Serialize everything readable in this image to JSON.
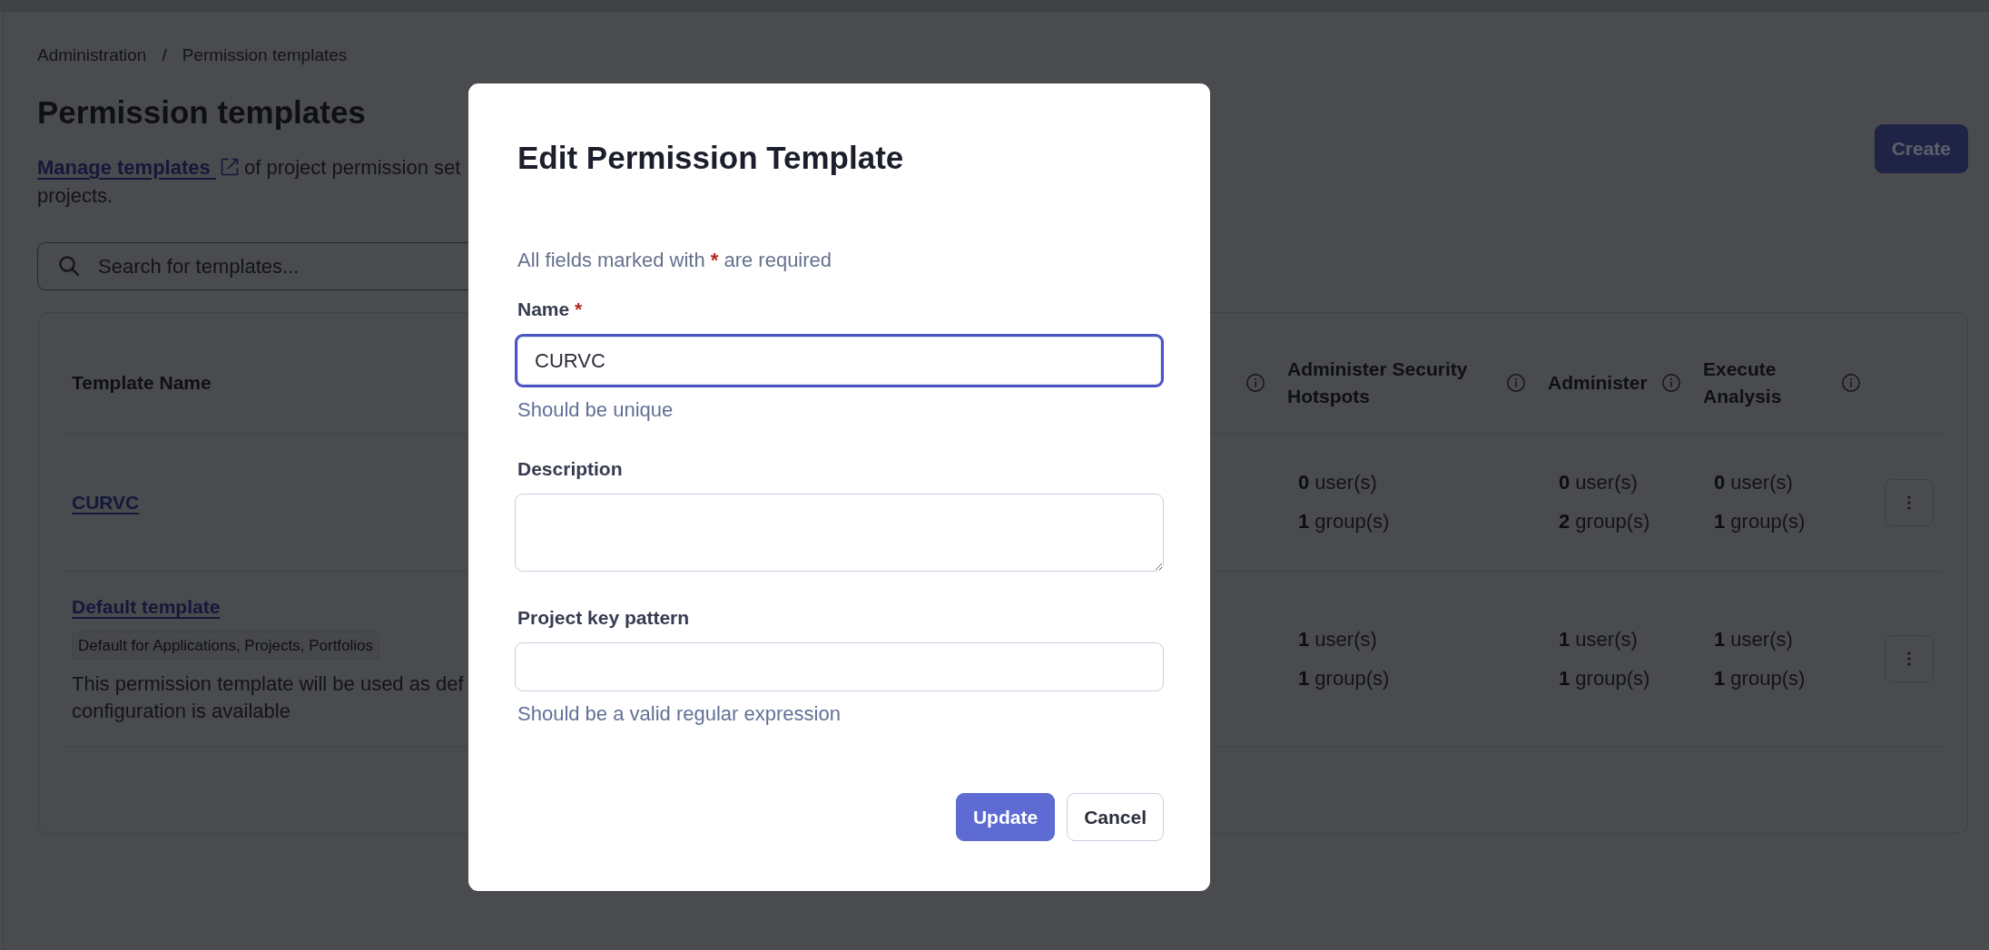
{
  "breadcrumbs": {
    "items": [
      "Administration",
      "Permission templates"
    ],
    "separator": "/"
  },
  "page": {
    "title": "Permission templates",
    "description": {
      "link": "Manage templates",
      "lines": [
        "of project permission set",
        "projects."
      ]
    },
    "create_button": "Create"
  },
  "search": {
    "placeholder": "Search for templates..."
  },
  "table": {
    "columns": [
      {
        "label": "Template Name"
      },
      {
        "info": true
      },
      {
        "label": "Administer Security Hotspots",
        "info": true
      },
      {
        "label": "Administer",
        "info": true
      },
      {
        "label": "Execute Analysis",
        "info": true
      }
    ],
    "rows": [
      {
        "cells": [
          {
            "link": "CURVC"
          },
          "",
          [
            "**0** user(s)",
            "**1** group(s)"
          ],
          [
            "**0** user(s)",
            "**2** group(s)"
          ],
          [
            "**0** user(s)",
            "**1** group(s)"
          ]
        ]
      },
      {
        "cells": [
          {
            "link": "Default template",
            "tag": "Default for Applications, Projects, Portfolios",
            "description": [
              "This permission template will be used as def",
              "configuration is available"
            ]
          },
          "",
          [
            "**1** user(s)",
            "**1** group(s)"
          ],
          [
            "**1** user(s)",
            "**1** group(s)"
          ],
          [
            "**1** user(s)",
            "**1** group(s)"
          ]
        ]
      }
    ]
  },
  "dialog": {
    "title": "Edit Permission Template",
    "required_note": {
      "before": "All fields marked with",
      "mark": "*",
      "after": "are required"
    },
    "fields": [
      {
        "kind": "input",
        "label": "Name",
        "required_mark": "*",
        "value": "CURVC",
        "focused": true,
        "hint": "Should be unique"
      },
      {
        "kind": "textarea",
        "label": "Description",
        "focused": false
      },
      {
        "kind": "input",
        "label": "Project key pattern",
        "focused": false,
        "hint": "Should be a valid regular expression"
      }
    ],
    "buttons": [
      {
        "label": "Update",
        "kind": "primary"
      },
      {
        "label": "Cancel",
        "kind": "secondary"
      }
    ]
  }
}
